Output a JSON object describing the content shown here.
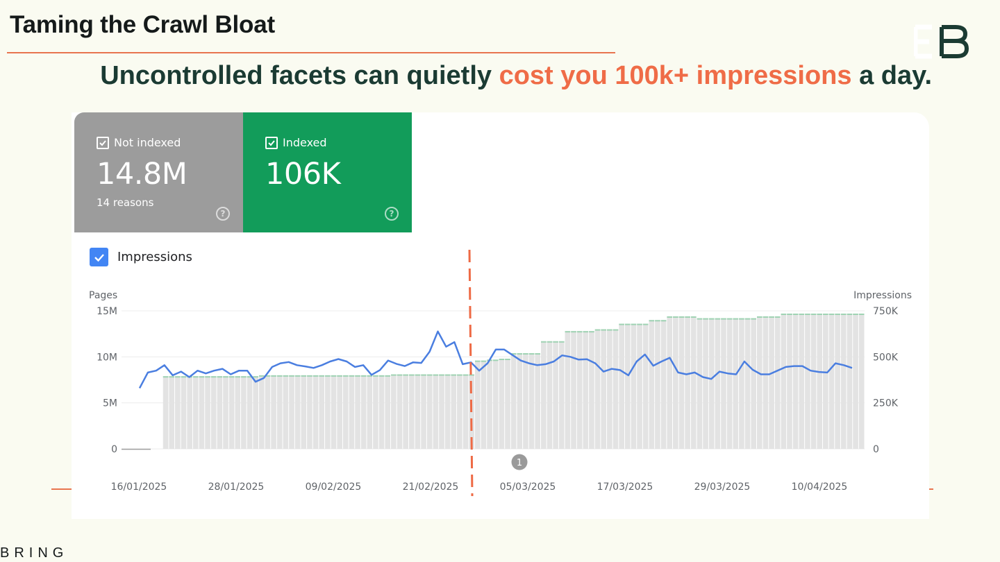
{
  "slide": {
    "title": "Taming the Crawl Bloat",
    "headline_part1": "Uncontrolled facets can quietly ",
    "headline_accent": "cost you 100k+ impressions",
    "headline_part2": " a day.",
    "brand_mark": "BRING",
    "colors": {
      "accent": "#ef6c47",
      "headline": "#1b3b33",
      "background": "#fafbf1"
    }
  },
  "summary_tiles": [
    {
      "label": "Not indexed",
      "value": "14.8M",
      "sub": "14 reasons",
      "color": "#9c9c9c",
      "icon": "help-icon"
    },
    {
      "label": "Indexed",
      "value": "106K",
      "sub": "",
      "color": "#129c5a",
      "icon": "help-icon"
    }
  ],
  "metric_toggle": {
    "label": "Impressions",
    "checked": true,
    "color": "#4285f4"
  },
  "chart_data": {
    "type": "bar",
    "ylabel": "Pages",
    "y2label": "Impressions",
    "ylim": [
      0,
      15000000
    ],
    "y2lim": [
      0,
      750000
    ],
    "yticks": [
      "15M",
      "10M",
      "5M",
      "0"
    ],
    "y2ticks": [
      "750K",
      "500K",
      "250K",
      "0"
    ],
    "x_tick_labels": [
      "16/01/2025",
      "28/01/2025",
      "09/02/2025",
      "21/02/2025",
      "05/03/2025",
      "17/03/2025",
      "29/03/2025",
      "10/04/2025"
    ],
    "annotation": "1",
    "grid": true,
    "series": [
      {
        "type": "bar",
        "color": "#e3e3e3",
        "values": [
          0,
          0,
          7.9,
          7.9,
          7.9,
          7.9,
          7.9,
          7.9,
          7.9,
          7.9,
          7.9,
          7.9,
          7.9,
          7.9,
          7.9,
          7.9,
          7.9,
          7.9,
          8.0,
          8.0,
          8.0,
          8.0,
          8.0,
          8.0,
          8.0,
          8.0,
          8.0,
          8.0,
          8.0,
          8.0,
          8.0,
          8.0,
          8.0,
          8.0,
          8.0,
          8.0,
          8.0,
          8.0,
          8.0,
          8.0,
          8.1,
          8.1,
          8.1,
          8.1,
          8.1,
          8.1,
          8.1,
          8.1,
          8.1,
          8.1,
          8.1,
          8.1,
          8.1,
          8.1,
          9.6,
          9.6,
          9.7,
          9.7,
          9.8,
          9.8,
          10.4,
          10.4,
          10.4,
          10.4,
          10.4,
          11.7,
          11.7,
          11.7,
          11.7,
          12.8,
          12.8,
          12.8,
          12.8,
          12.8,
          13.0,
          13.0,
          13.0,
          13.0,
          13.6,
          13.6,
          13.6,
          13.6,
          13.6,
          14.0,
          14.0,
          14.0,
          14.4,
          14.4,
          14.4,
          14.4,
          14.4,
          14.2,
          14.2,
          14.2,
          14.2,
          14.2,
          14.2,
          14.2,
          14.2,
          14.2,
          14.2,
          14.4,
          14.4,
          14.4,
          14.4,
          14.7,
          14.7,
          14.7,
          14.7,
          14.7,
          14.7,
          14.7,
          14.7,
          14.7,
          14.7,
          14.7,
          14.7,
          14.7,
          14.7
        ]
      },
      {
        "type": "line",
        "axis": "right",
        "color": "#4a7ee0",
        "values": [
          330,
          415,
          425,
          455,
          400,
          420,
          390,
          425,
          410,
          425,
          435,
          405,
          425,
          425,
          365,
          385,
          445,
          465,
          472,
          455,
          448,
          440,
          455,
          475,
          488,
          475,
          445,
          455,
          402,
          428,
          480,
          462,
          450,
          470,
          467,
          528,
          638,
          555,
          580,
          460,
          470,
          425,
          465,
          540,
          540,
          510,
          480,
          465,
          455,
          460,
          475,
          508,
          500,
          485,
          487,
          465,
          420,
          435,
          428,
          400,
          475,
          513,
          452,
          475,
          495,
          415,
          405,
          415,
          390,
          380,
          420,
          410,
          405,
          475,
          430,
          405,
          405,
          425,
          445,
          450,
          450,
          425,
          418,
          415,
          465,
          455,
          440
        ]
      }
    ]
  }
}
